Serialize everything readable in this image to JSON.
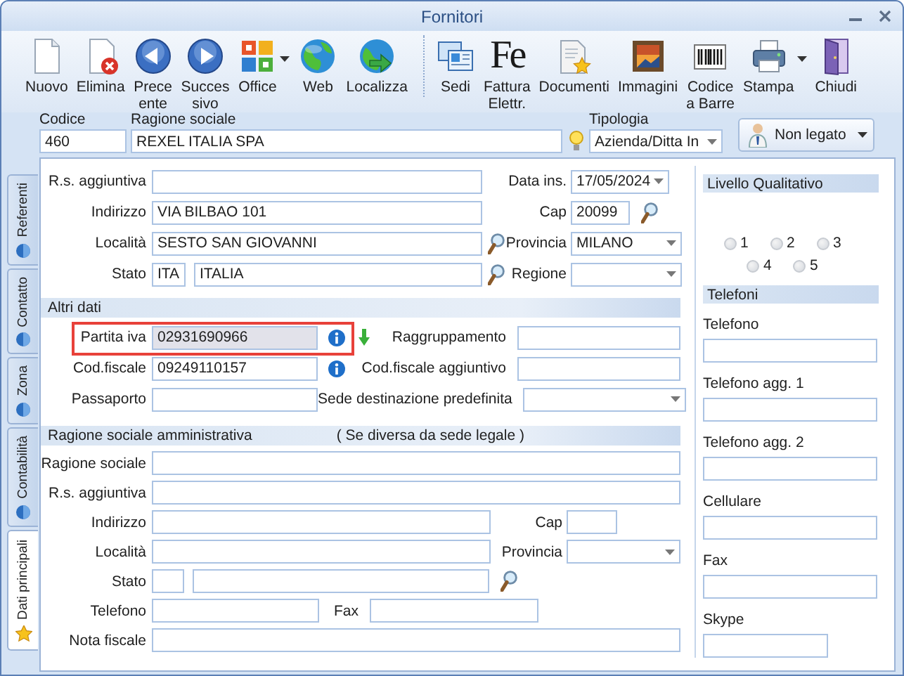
{
  "window": {
    "title": "Fornitori"
  },
  "toolbar": [
    {
      "label": "Nuovo",
      "menu": false,
      "separator_before": false
    },
    {
      "label": "Elimina",
      "menu": false,
      "separator_before": false
    },
    {
      "label": "Prece\nente",
      "menu": false,
      "separator_before": false
    },
    {
      "label": "Succes\nsivo",
      "menu": false,
      "separator_before": false
    },
    {
      "label": "Office",
      "menu": true,
      "separator_before": false
    },
    {
      "label": "Web",
      "menu": false,
      "separator_before": false
    },
    {
      "label": "Localizza",
      "menu": false,
      "separator_before": false
    },
    {
      "label": "Sedi",
      "menu": false,
      "separator_before": true
    },
    {
      "label": "Fattura\nElettr.",
      "logo": "Fe",
      "menu": false,
      "separator_before": false
    },
    {
      "label": "Documenti",
      "menu": false,
      "separator_before": false
    },
    {
      "label": "Immagini",
      "menu": false,
      "separator_before": false
    },
    {
      "label": "Codice\na Barre",
      "menu": false,
      "separator_before": false
    },
    {
      "label": "Stampa",
      "menu": true,
      "separator_before": false
    },
    {
      "label": "Chiudi",
      "menu": false,
      "separator_before": false
    }
  ],
  "header": {
    "codice": {
      "label": "Codice",
      "value": "460"
    },
    "ragione_sociale": {
      "label": "Ragione sociale",
      "value": "REXEL ITALIA SPA"
    },
    "tipologia": {
      "label": "Tipologia",
      "value": "Azienda/Ditta In"
    },
    "link_button": {
      "label": "Non legato"
    }
  },
  "side_tabs": [
    {
      "label": "Referenti",
      "selected": false
    },
    {
      "label": "Contatto",
      "selected": false
    },
    {
      "label": "Zona",
      "selected": false
    },
    {
      "label": "Contabilità",
      "selected": false
    },
    {
      "label": "Dati principali",
      "selected": true
    }
  ],
  "sede": {
    "rows": [
      {
        "label": "R.s. aggiuntiva",
        "fields": [
          {
            "kind": "text"
          }
        ],
        "side": {
          "label": "Data ins.",
          "field": {
            "kind": "date",
            "value": "17/05/2024"
          }
        }
      },
      {
        "label": "Indirizzo",
        "fields": [
          {
            "kind": "text",
            "value": "VIA BILBAO 101"
          }
        ],
        "side": {
          "label": "Cap",
          "field": {
            "kind": "text",
            "value": "20099"
          }
        }
      },
      {
        "label": "Località",
        "fields": [
          {
            "kind": "text",
            "value": "SESTO SAN GIOVANNI"
          }
        ],
        "side": {
          "label": "Provincia",
          "field": {
            "kind": "dropdown",
            "value": "MILANO"
          }
        }
      },
      {
        "label": "Stato",
        "fields": [
          {
            "kind": "text",
            "value": "ITA"
          },
          {
            "kind": "text",
            "value": "ITALIA"
          }
        ],
        "side": {
          "label": "Regione",
          "field": {
            "kind": "dropdown"
          }
        }
      }
    ]
  },
  "altri_dati": {
    "title": "Altri dati",
    "rows": [
      {
        "label": "Partita iva",
        "fields": [
          {
            "kind": "readonly",
            "value": "02931690966"
          }
        ],
        "side": {
          "label": "Raggruppamento",
          "field": {
            "kind": "text"
          }
        }
      },
      {
        "label": "Cod.fiscale",
        "fields": [
          {
            "kind": "text",
            "value": "09249110157"
          }
        ],
        "side": {
          "label": "Cod.fiscale aggiuntivo",
          "field": {
            "kind": "text"
          }
        }
      },
      {
        "label": "Passaporto",
        "fields": [
          {
            "kind": "text"
          }
        ],
        "side": {
          "label": "Sede destinazione predefinita",
          "field": {
            "kind": "dropdown"
          }
        }
      }
    ]
  },
  "amministrativa": {
    "title": "Ragione sociale amministrativa",
    "note": "( Se diversa da sede legale )",
    "rows": [
      {
        "label": "Ragione sociale",
        "fields": [
          {
            "kind": "text"
          }
        ]
      },
      {
        "label": "R.s. aggiuntiva",
        "fields": [
          {
            "kind": "text"
          }
        ]
      },
      {
        "label": "Indirizzo",
        "fields": [
          {
            "kind": "text"
          }
        ],
        "side": {
          "label": "Cap",
          "field": {
            "kind": "text"
          }
        }
      },
      {
        "label": "Località",
        "fields": [
          {
            "kind": "text"
          }
        ],
        "side": {
          "label": "Provincia",
          "field": {
            "kind": "dropdown"
          }
        }
      },
      {
        "label": "Stato",
        "fields": [
          {
            "kind": "text"
          },
          {
            "kind": "text"
          }
        ]
      },
      {
        "label": "Telefono",
        "fields": [
          {
            "kind": "text"
          }
        ],
        "side": {
          "label": "Fax",
          "field": {
            "kind": "text"
          }
        }
      },
      {
        "label": "Nota fiscale",
        "fields": [
          {
            "kind": "text"
          }
        ]
      }
    ]
  },
  "livello_qualitativo": {
    "title": "Livello Qualitativo",
    "options": [
      {
        "label": "1",
        "selected": false
      },
      {
        "label": "2",
        "selected": false
      },
      {
        "label": "3",
        "selected": false
      },
      {
        "label": "4",
        "selected": false
      },
      {
        "label": "5",
        "selected": false
      }
    ]
  },
  "telefoni": {
    "title": "Telefoni",
    "fields": [
      {
        "label": "Telefono"
      },
      {
        "label": "Telefono agg. 1"
      },
      {
        "label": "Telefono agg. 2"
      },
      {
        "label": "Cellulare"
      },
      {
        "label": "Fax"
      },
      {
        "label": "Skype"
      }
    ]
  }
}
